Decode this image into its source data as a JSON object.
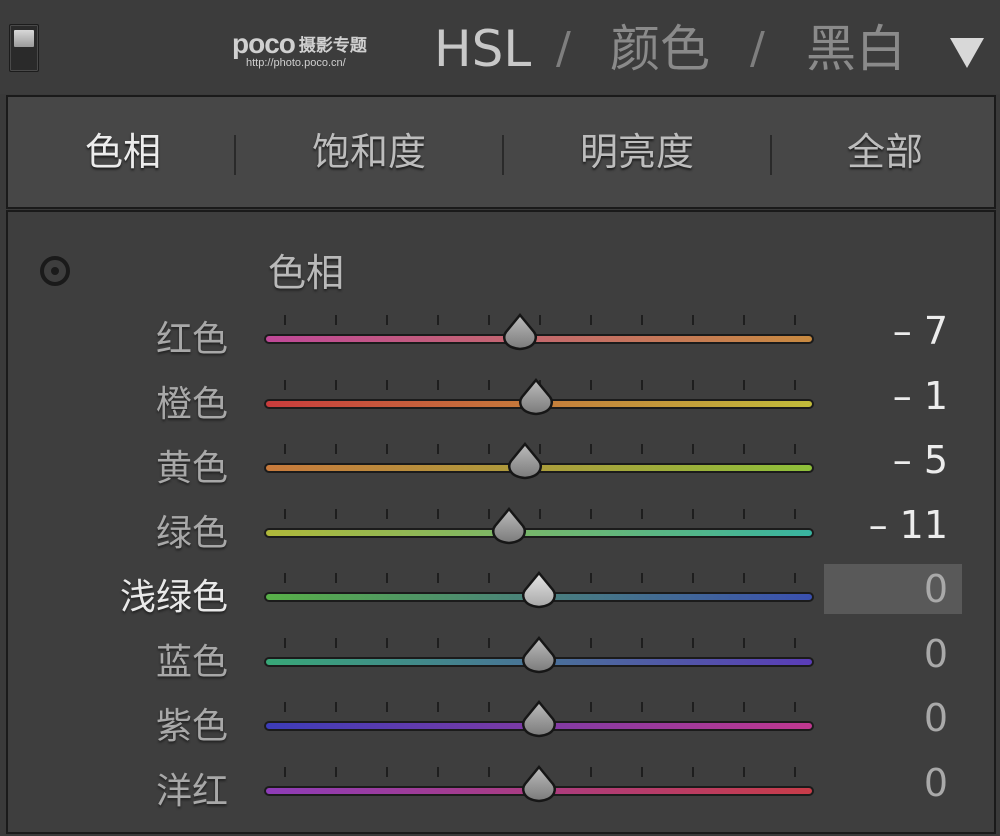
{
  "header": {
    "watermark": {
      "logo": "poco",
      "text": "摄影专题",
      "url": "http://photo.poco.cn/"
    },
    "nav": [
      {
        "label": "HSL",
        "active": true
      },
      {
        "label": "颜色",
        "active": false
      },
      {
        "label": "黑白",
        "active": false
      }
    ],
    "separator": "/",
    "collapse_icon": "triangle-down-icon"
  },
  "tabs": [
    {
      "label": "色相",
      "active": true
    },
    {
      "label": "饱和度",
      "active": false
    },
    {
      "label": "明亮度",
      "active": false
    },
    {
      "label": "全部",
      "active": false
    }
  ],
  "panel": {
    "target_icon": "target-adjust-icon",
    "title": "色相",
    "slider_range": [
      -100,
      100
    ],
    "sliders": [
      {
        "label": "红色",
        "value": -7,
        "display": "– 7",
        "from": "#c04898",
        "to": "#c88a40"
      },
      {
        "label": "橙色",
        "value": -1,
        "display": "– 1",
        "from": "#c83c3c",
        "to": "#c2bc3a"
      },
      {
        "label": "黄色",
        "value": -5,
        "display": "– 5",
        "from": "#c87a3c",
        "to": "#8ec03a"
      },
      {
        "label": "绿色",
        "value": -11,
        "display": "– 11",
        "from": "#b0b83a",
        "to": "#38b4a0"
      },
      {
        "label": "浅绿色",
        "value": 0,
        "display": "0",
        "from": "#58b048",
        "to": "#3a50b0",
        "active": true
      },
      {
        "label": "蓝色",
        "value": 0,
        "display": "0",
        "from": "#38a878",
        "to": "#5a3cb8"
      },
      {
        "label": "紫色",
        "value": 0,
        "display": "0",
        "from": "#3c3cb8",
        "to": "#c03890"
      },
      {
        "label": "洋红",
        "value": 0,
        "display": "0",
        "from": "#8e3cb8",
        "to": "#c83c48"
      }
    ]
  }
}
